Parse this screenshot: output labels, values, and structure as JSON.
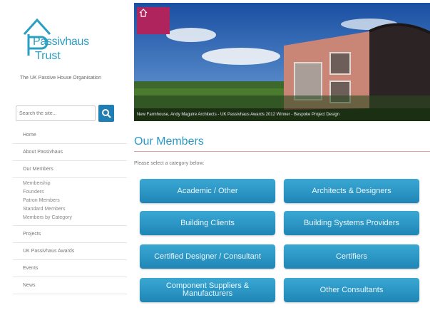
{
  "brand": {
    "name_line1": "Passivhaus",
    "name_line2": "Trust",
    "tagline": "The UK Passive House Organisation",
    "color": "#2a9fc4"
  },
  "search": {
    "placeholder": "Search the site...",
    "button_icon": "search-icon"
  },
  "sidebar": {
    "items": [
      {
        "label": "Home"
      },
      {
        "label": "About Passivhaus"
      },
      {
        "label": "Our Members"
      }
    ],
    "sub_items": [
      {
        "label": "Membership"
      },
      {
        "label": "Founders"
      },
      {
        "label": "Patron Members"
      },
      {
        "label": "Standard Members"
      },
      {
        "label": "Members by Category"
      }
    ],
    "items_after": [
      {
        "label": "Projects"
      },
      {
        "label": "UK Passivhaus Awards"
      },
      {
        "label": "Events"
      },
      {
        "label": "News"
      }
    ]
  },
  "hero": {
    "caption": "New Farmhouse, Andy Maguire Architects - UK Passivhaus Awards 2012 Winner - Bespoke Project Design"
  },
  "main": {
    "title": "Our Members",
    "subtitle": "Please select a category below:",
    "accent_rule_color": "#e0a0a0",
    "buttons": [
      {
        "label": "Academic / Other"
      },
      {
        "label": "Architects & Designers"
      },
      {
        "label": "Building Clients"
      },
      {
        "label": "Building Systems Providers"
      },
      {
        "label": "Certified Designer / Consultant"
      },
      {
        "label": "Certifiers"
      },
      {
        "label": "Component Suppliers & Manufacturers"
      },
      {
        "label": "Other Consultants"
      }
    ],
    "button_color": "#2a96c6"
  }
}
